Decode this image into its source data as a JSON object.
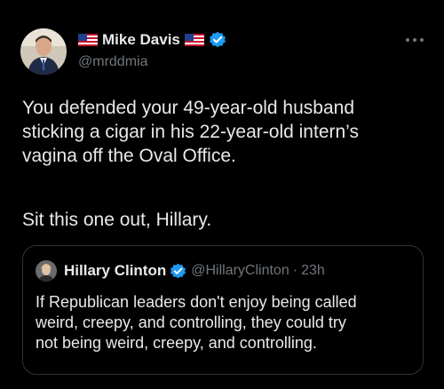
{
  "post": {
    "author": {
      "display_name": "Mike Davis",
      "handle": "@mrddmia",
      "verified": true
    },
    "text_paragraph_1": "You defended your 49-year-old husband\nsticking a cigar in his 22-year-old intern’s\nvagina off the Oval Office.",
    "text_paragraph_2": "Sit this one out, Hillary.",
    "more_icon": "more-horizontal-icon",
    "quote": {
      "display_name": "Hillary Clinton",
      "handle": "@HillaryClinton",
      "separator": "·",
      "time": "23h",
      "verified": true,
      "text": "If Republican leaders don't enjoy being called\nweird, creepy, and controlling, they could try\nnot being weird, creepy, and controlling."
    }
  },
  "colors": {
    "background": "#000000",
    "text_primary": "#e7e9ea",
    "text_secondary": "#71767b",
    "verified_blue": "#1d9bf0",
    "quote_border": "#2f3336"
  },
  "icons": {
    "flag": "us-flag-icon",
    "verified": "verified-badge-icon"
  }
}
